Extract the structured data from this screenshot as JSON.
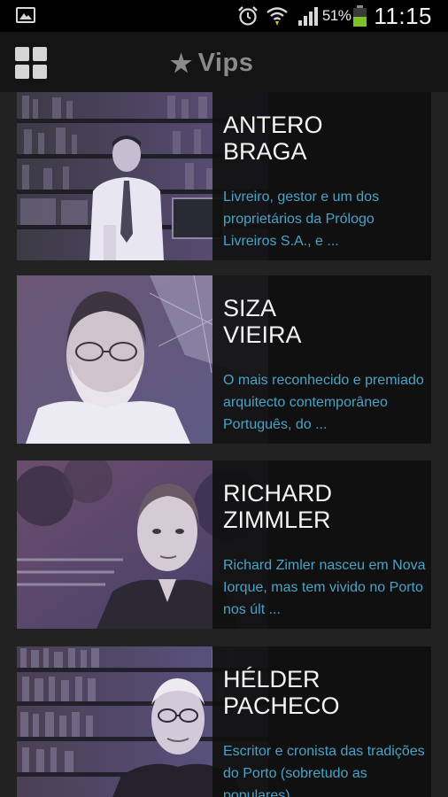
{
  "status_bar": {
    "battery_percent": "51%",
    "battery_level": 0.51,
    "time": "11:15",
    "icons": [
      "gallery-icon",
      "alarm-icon",
      "wifi-icon",
      "signal-icon",
      "battery-icon"
    ]
  },
  "app_bar": {
    "title": "Vips",
    "title_icon": "star-icon",
    "menu_icon": "grid-menu-icon"
  },
  "vips": [
    {
      "name_line1": "ANTERO",
      "name_line2": "BRAGA",
      "description": "Livreiro, gestor e um dos proprietários da Prólogo Livreiros S.A., e ..."
    },
    {
      "name_line1": "SIZA",
      "name_line2": "VIEIRA",
      "description": "O mais reconhecido e premiado arquitecto contemporâneo Português, do ..."
    },
    {
      "name_line1": "RICHARD",
      "name_line2": "ZIMMLER",
      "description": "Richard Zimler nasceu em Nova Iorque, mas tem vivido no Porto nos últ ..."
    },
    {
      "name_line1": "HÉLDER",
      "name_line2": "PACHECO",
      "description": "Escritor e cronista das tradições do Porto (sobretudo as populares), ..."
    }
  ],
  "colors": {
    "background": "#222222",
    "card": "#141414",
    "accent_link": "#4aa3c6",
    "photo_tint": "#7b63a8"
  }
}
